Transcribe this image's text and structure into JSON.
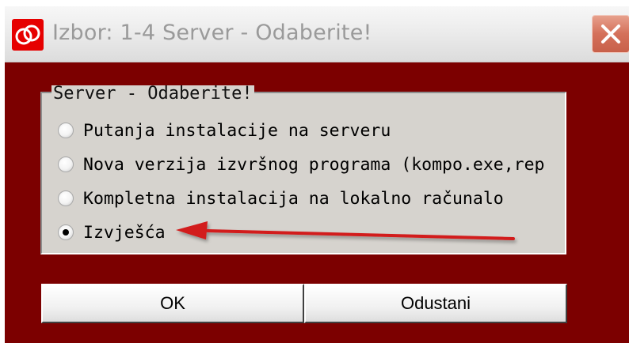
{
  "window": {
    "title": "Izbor: 1-4 Server - Odaberite!",
    "app_icon": "app-logo-icon",
    "close_icon": "close-icon"
  },
  "group": {
    "legend": "Server - Odaberite!",
    "options": [
      {
        "label": "Putanja instalacije na serveru",
        "selected": false
      },
      {
        "label": "Nova verzija izvršnog programa (kompo.exe,rep",
        "selected": false
      },
      {
        "label": "Kompletna instalacija na lokalno računalo",
        "selected": false
      },
      {
        "label": "Izvješća",
        "selected": true
      }
    ]
  },
  "buttons": {
    "ok_label": "OK",
    "cancel_label": "Odustani"
  },
  "colors": {
    "window_bg": "#7c0000",
    "group_bg": "#d6d3ce",
    "arrow": "#d21a1a",
    "close_button": "#d4705a"
  },
  "annotation": {
    "arrow_icon": "red-arrow-annotation"
  }
}
